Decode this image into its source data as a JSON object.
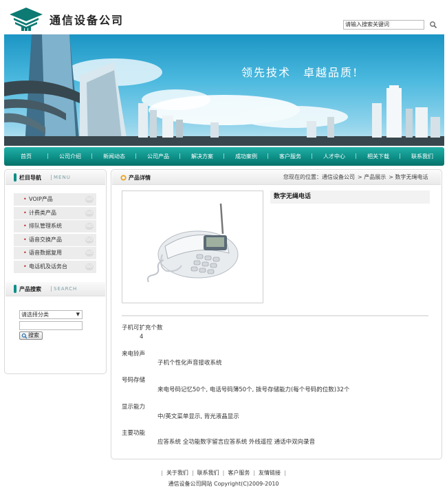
{
  "header": {
    "company_name": "通信设备公司",
    "search_placeholder": "请输入搜索关键词",
    "search_icon": "magnifier-icon"
  },
  "banner": {
    "slogan": "领先技术　卓越品质!"
  },
  "nav": {
    "items": [
      "首页",
      "公司介绍",
      "新闻动态",
      "公司产品",
      "解决方案",
      "成功案例",
      "客户服务",
      "人才中心",
      "相关下载",
      "联系我们"
    ]
  },
  "sidebar": {
    "nav_title": "栏目导航",
    "nav_title_en": "MENU",
    "categories": [
      "VOIP产品",
      "计费类产品",
      "排队管理系统",
      "语音交换产品",
      "语音数据复用",
      "电话机及话务台"
    ],
    "go_label": "GO",
    "search_title": "产品搜索",
    "search_title_en": "SEARCH",
    "select_value": "请选择分类",
    "search_button": "搜索"
  },
  "main": {
    "title": "产品详情",
    "breadcrumb": [
      "您现在的位置：通信设备公司",
      "> 产品展示",
      "> 数字无绳电话"
    ],
    "product_name": "数字无绳电话",
    "specs": [
      {
        "label": "子机可扩充个数",
        "value": "4"
      },
      {
        "label": "来电铃声",
        "value": "子机个性化声音接收系统"
      },
      {
        "label": "号码存储",
        "value": "来电号码记忆50个, 电话号码薄50个, 拨号存储能力(每个号码的位数)32个"
      },
      {
        "label": "显示能力",
        "value": "中/英文菜单显示, 背光液晶显示"
      },
      {
        "label": "主要功能",
        "value": "应答系统  全功能数字留言应答系统  外线遥控  通话中双向录音"
      }
    ]
  },
  "footer": {
    "links": [
      "关于我们",
      "联系我们",
      "客户服务",
      "友情链接"
    ],
    "copyright": "通信设备公司网站   Copyright(C)2009-2010"
  },
  "colors": {
    "nav_teal": "#0d8f87",
    "banner_sky": "#4ab8de",
    "bullet_red": "#c02020"
  }
}
